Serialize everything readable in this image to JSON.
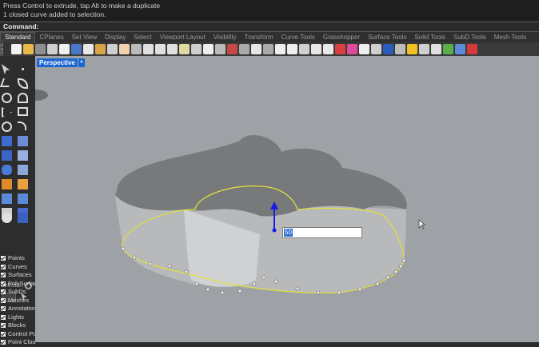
{
  "history": {
    "line1": "Press Control to extrude, tap Alt to make a duplicate",
    "line2": "1 closed curve added to selection."
  },
  "command": {
    "label": "Command:"
  },
  "tabs": [
    "Standard",
    "CPlanes",
    "Set View",
    "Display",
    "Select",
    "Viewport Layout",
    "Visibility",
    "Transform",
    "Curve Tools",
    "Grasshopper",
    "Surface Tools",
    "Solid Tools",
    "SubD Tools",
    "Mesh Tools"
  ],
  "sidebar_label": "Stand...",
  "viewport": {
    "name": "Perspective",
    "arrow": "▾"
  },
  "panel": {
    "title": "Selectio..."
  },
  "filter_items": [
    "Points",
    "Curves",
    "Surfaces",
    "PolySurfaces",
    "SubDs",
    "Meshes",
    "Annotations",
    "Lights",
    "Blocks",
    "Control Points",
    "Point Clouds"
  ],
  "extrude_input": {
    "value": "50"
  },
  "colors": {
    "accent": "#1e66d0",
    "curve": "#e4e03a",
    "gumball_z": "#1a1ae6"
  }
}
